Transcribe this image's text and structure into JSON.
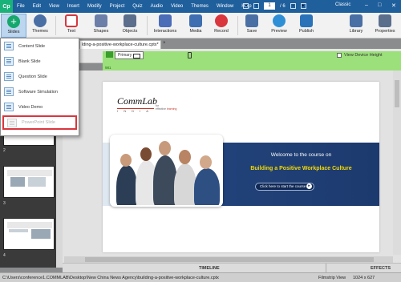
{
  "menubar": {
    "logo": "Cp",
    "items": [
      "File",
      "Edit",
      "View",
      "Insert",
      "Modify",
      "Project",
      "Quiz",
      "Audio",
      "Video",
      "Themes",
      "Window",
      "Help"
    ],
    "current_page": "1",
    "total_pages": "/ 6",
    "workspace": "Classic",
    "controls": {
      "minimize": "–",
      "maximize": "□",
      "close": "✕"
    }
  },
  "toolbar": {
    "slides": "Slides",
    "themes": "Themes",
    "text": "Text",
    "shapes": "Shapes",
    "objects": "Objects",
    "interactions": "Interactions",
    "media": "Media",
    "record": "Record",
    "save": "Save",
    "preview": "Preview",
    "publish": "Publish",
    "library": "Library",
    "properties": "Properties"
  },
  "slides_menu": {
    "items": [
      {
        "label": "Content Slide",
        "enabled": true
      },
      {
        "label": "Blank Slide",
        "enabled": true
      },
      {
        "label": "Question Slide",
        "enabled": true
      },
      {
        "label": "Software Simulation",
        "enabled": true
      },
      {
        "label": "Video Demo",
        "enabled": true
      },
      {
        "label": "PowerPoint Slide",
        "enabled": false
      }
    ]
  },
  "filmstrip": {
    "numbers": [
      "2",
      "3",
      "4"
    ]
  },
  "document": {
    "tab_title": "lding-a-positive-workplace-culture.cptx*",
    "tab_close": "×",
    "primary_label": "Primary",
    "view_device_height": "View Device Height",
    "ruler_value": "981"
  },
  "slide": {
    "logo_main": "CommLab",
    "logo_sub": "I N D I A",
    "logo_tag_1": "for",
    "logo_tag_2": "effective",
    "logo_tag_3": "learning",
    "welcome": "Welcome to the course on",
    "course_title": "Building a Positive Workplace Culture",
    "start_button": "Click here to start the course"
  },
  "bottom": {
    "timeline": "TIMELINE",
    "effects": "EFFECTS"
  },
  "status": {
    "path": "C:\\Users\\conference1.COMMLAB\\Desktop\\New China News Agency\\building-a-positive-workplace-culture.cptx",
    "view": "Filmstrip View",
    "size": "1024 x 627"
  },
  "colors": {
    "menubar": "#1f5f9c",
    "accent_green": "#16a76c",
    "highlight_red": "#d9363e",
    "banner_blue": "#1d3a6e",
    "title_yellow": "#f6d900"
  }
}
